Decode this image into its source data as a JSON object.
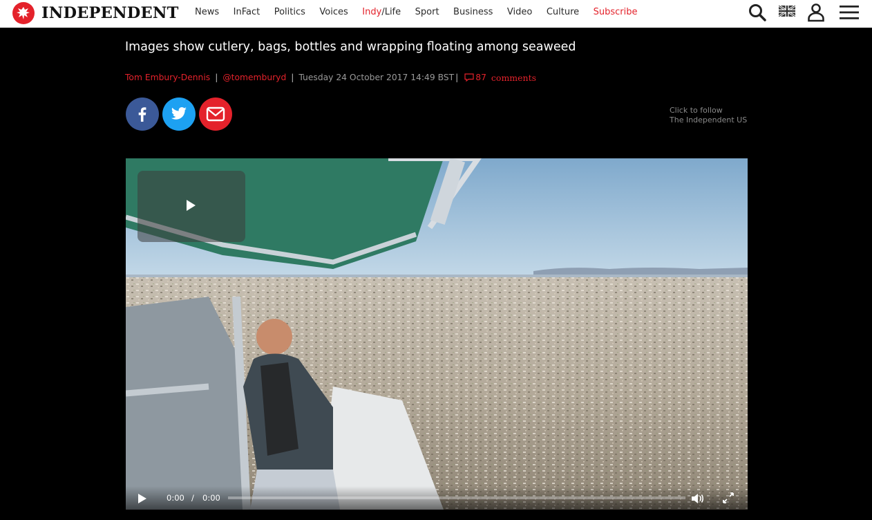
{
  "site": {
    "logo_text": "INDEPENDENT"
  },
  "nav": {
    "items": [
      {
        "label": "News",
        "color": "#2a2a2a"
      },
      {
        "label": "InFact",
        "color": "#2a2a2a"
      },
      {
        "label": "Politics",
        "color": "#2a2a2a"
      },
      {
        "label": "Voices",
        "color": "#2a2a2a"
      }
    ],
    "indy_prefix": "Indy",
    "indy_slash": "/",
    "indy_suffix": "Life",
    "items_after": [
      {
        "label": "Sport"
      },
      {
        "label": "Business"
      },
      {
        "label": "Video"
      },
      {
        "label": "Culture"
      }
    ],
    "subscribe": "Subscribe",
    "accent_color": "#e4222b"
  },
  "toolbar": {
    "search_icon": "search-icon",
    "region_icon": "uk-flag-icon",
    "account_icon": "user-icon",
    "menu_icon": "hamburger-menu-icon"
  },
  "article": {
    "headline": "Images show cutlery, bags, bottles and wrapping floating among seaweed",
    "author": "Tom Embury-Dennis",
    "handle": "@tomemburyd",
    "date": "Tuesday 24 October 2017 14:49 BST",
    "comment_count": "87",
    "comments_label": "comments"
  },
  "share": {
    "facebook_icon": "facebook-icon",
    "twitter_icon": "twitter-icon",
    "email_icon": "email-icon",
    "facebook_color": "#3b5998",
    "twitter_color": "#1da1f2",
    "email_color": "#e4222b"
  },
  "follow": {
    "line1": "Click to follow",
    "line2": "The Independent US"
  },
  "video": {
    "current_time": "0:00",
    "time_separator": "/",
    "duration": "0:00",
    "progress": 0
  }
}
